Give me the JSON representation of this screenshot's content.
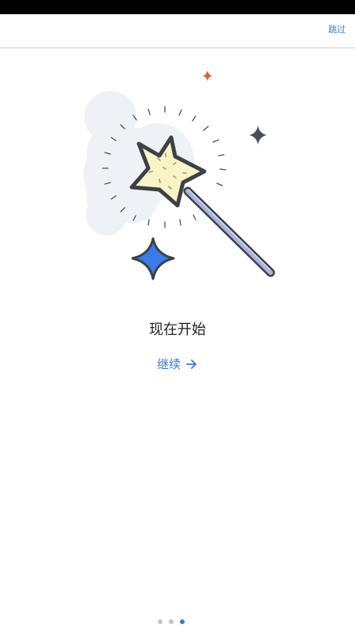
{
  "app_bar": {
    "skip_label": "跳过"
  },
  "main": {
    "title": "现在开始",
    "continue_label": "继续"
  },
  "page_indicator": {
    "count": 3,
    "active_index": 2
  },
  "illustration": {
    "icons": [
      "magic-wand-icon",
      "sparkle-icon",
      "sparkle-icon",
      "sparkle-icon"
    ]
  },
  "colors": {
    "accent": "#3b78d1",
    "star_fill": "#f8f4c8",
    "wand": "#aab4e0",
    "outline": "#3c4147",
    "cloud": "#eef1f5",
    "sparkle_orange": "#e8583c",
    "sparkle_blue": "#3a7be6"
  }
}
